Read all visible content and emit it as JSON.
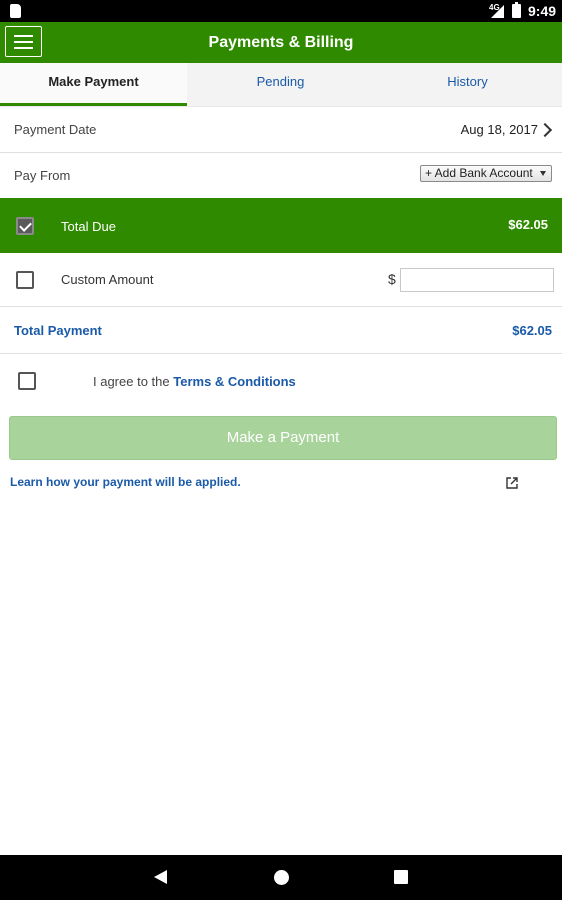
{
  "status_bar": {
    "network": "4G",
    "time": "9:49"
  },
  "app_bar": {
    "title": "Payments & Billing",
    "menu_icon": "hamburger-menu-icon"
  },
  "tabs": [
    {
      "label": "Make Payment",
      "active": true
    },
    {
      "label": "Pending",
      "active": false
    },
    {
      "label": "History",
      "active": false
    }
  ],
  "payment_date": {
    "label": "Payment Date",
    "value": "Aug 18, 2017"
  },
  "pay_from": {
    "label": "Pay From",
    "selected": "+ Add Bank Account"
  },
  "total_due": {
    "label": "Total Due",
    "amount": "$62.05",
    "checked": true
  },
  "custom_amount": {
    "label": "Custom Amount",
    "currency": "$",
    "value": ""
  },
  "total_payment": {
    "label": "Total Payment",
    "amount": "$62.05"
  },
  "agreement": {
    "prefix": "I agree to the",
    "link": "Terms & Conditions",
    "checked": false
  },
  "submit": {
    "label": "Make a Payment"
  },
  "learn_link": {
    "label": "Learn how your payment will be applied."
  },
  "colors": {
    "brand_green": "#2f8a00",
    "link_blue": "#1a5aa8",
    "disabled_button": "#a8d39a"
  }
}
